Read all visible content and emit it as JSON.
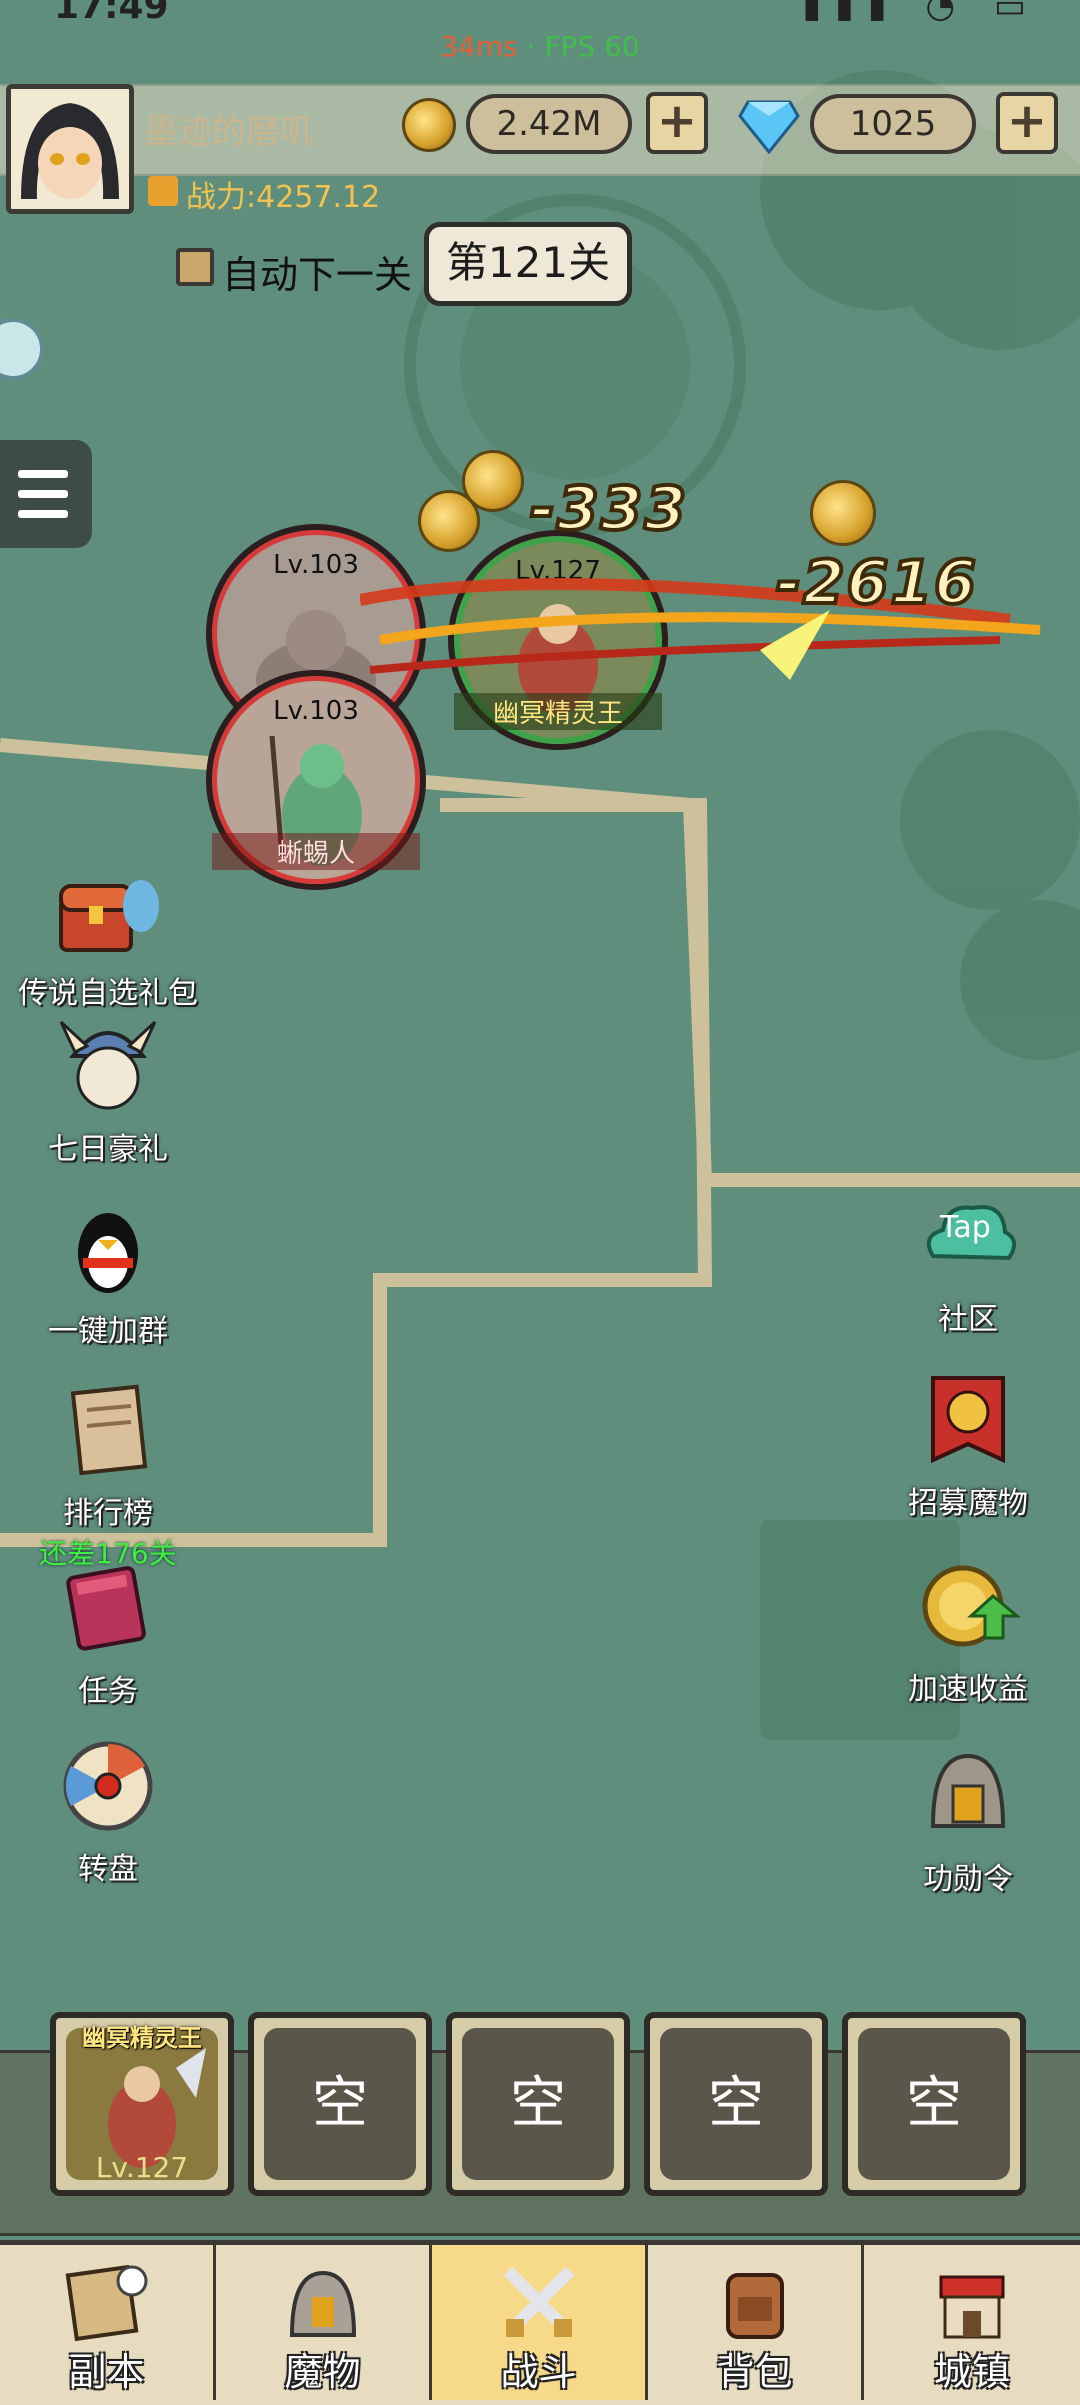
{
  "status_bar": {
    "time": "17:49",
    "ping": "34ms",
    "fps": "FPS 60",
    "separator": "·"
  },
  "player": {
    "name": "墨迹的磨叽",
    "power_label": "战力:4257.12"
  },
  "currency": {
    "gold": "2.42M",
    "gems": "1025",
    "plus": "+"
  },
  "stage": {
    "auto_next_label": "自动下一关",
    "current": "第121关"
  },
  "battle": {
    "enemies": [
      {
        "level": "Lv.103",
        "name": ""
      },
      {
        "level": "Lv.103",
        "name": "蜥蜴人"
      }
    ],
    "hero": {
      "level": "Lv.127",
      "name": "幽冥精灵王"
    },
    "damage_numbers": [
      "-333",
      "-2616"
    ]
  },
  "left_features": [
    {
      "label": "传说自选礼包",
      "icon": "treasure-chest-icon"
    },
    {
      "label": "七日豪礼",
      "icon": "viking-warrior-icon"
    },
    {
      "label": "一键加群",
      "icon": "penguin-icon"
    },
    {
      "label": "排行榜",
      "sub": "还差176关",
      "icon": "scroll-icon"
    },
    {
      "label": "任务",
      "icon": "book-icon"
    },
    {
      "label": "转盘",
      "icon": "wheel-icon"
    }
  ],
  "right_features": [
    {
      "label": "社区",
      "badge": "Tap",
      "icon": "cloud-icon"
    },
    {
      "label": "招募魔物",
      "icon": "banner-helmet-icon"
    },
    {
      "label": "加速收益",
      "icon": "coin-arrow-icon"
    },
    {
      "label": "功勋令",
      "icon": "helmet-icon"
    }
  ],
  "team": {
    "hero_slot": {
      "name": "幽冥精灵王",
      "level": "Lv.127"
    },
    "empty_label": "空"
  },
  "nav": [
    {
      "label": "副本",
      "icon": "map-icon",
      "active": false
    },
    {
      "label": "魔物",
      "icon": "monster-helmet-icon",
      "active": false
    },
    {
      "label": "战斗",
      "icon": "crossed-swords-icon",
      "active": true
    },
    {
      "label": "背包",
      "icon": "backpack-icon",
      "active": false
    },
    {
      "label": "城镇",
      "icon": "shop-icon",
      "active": false
    }
  ],
  "colors": {
    "map": "#5f8f7c",
    "nav_active": "#f7d98a",
    "enemy_ring": "#d83a3a",
    "hero_ring": "#3da24a"
  }
}
